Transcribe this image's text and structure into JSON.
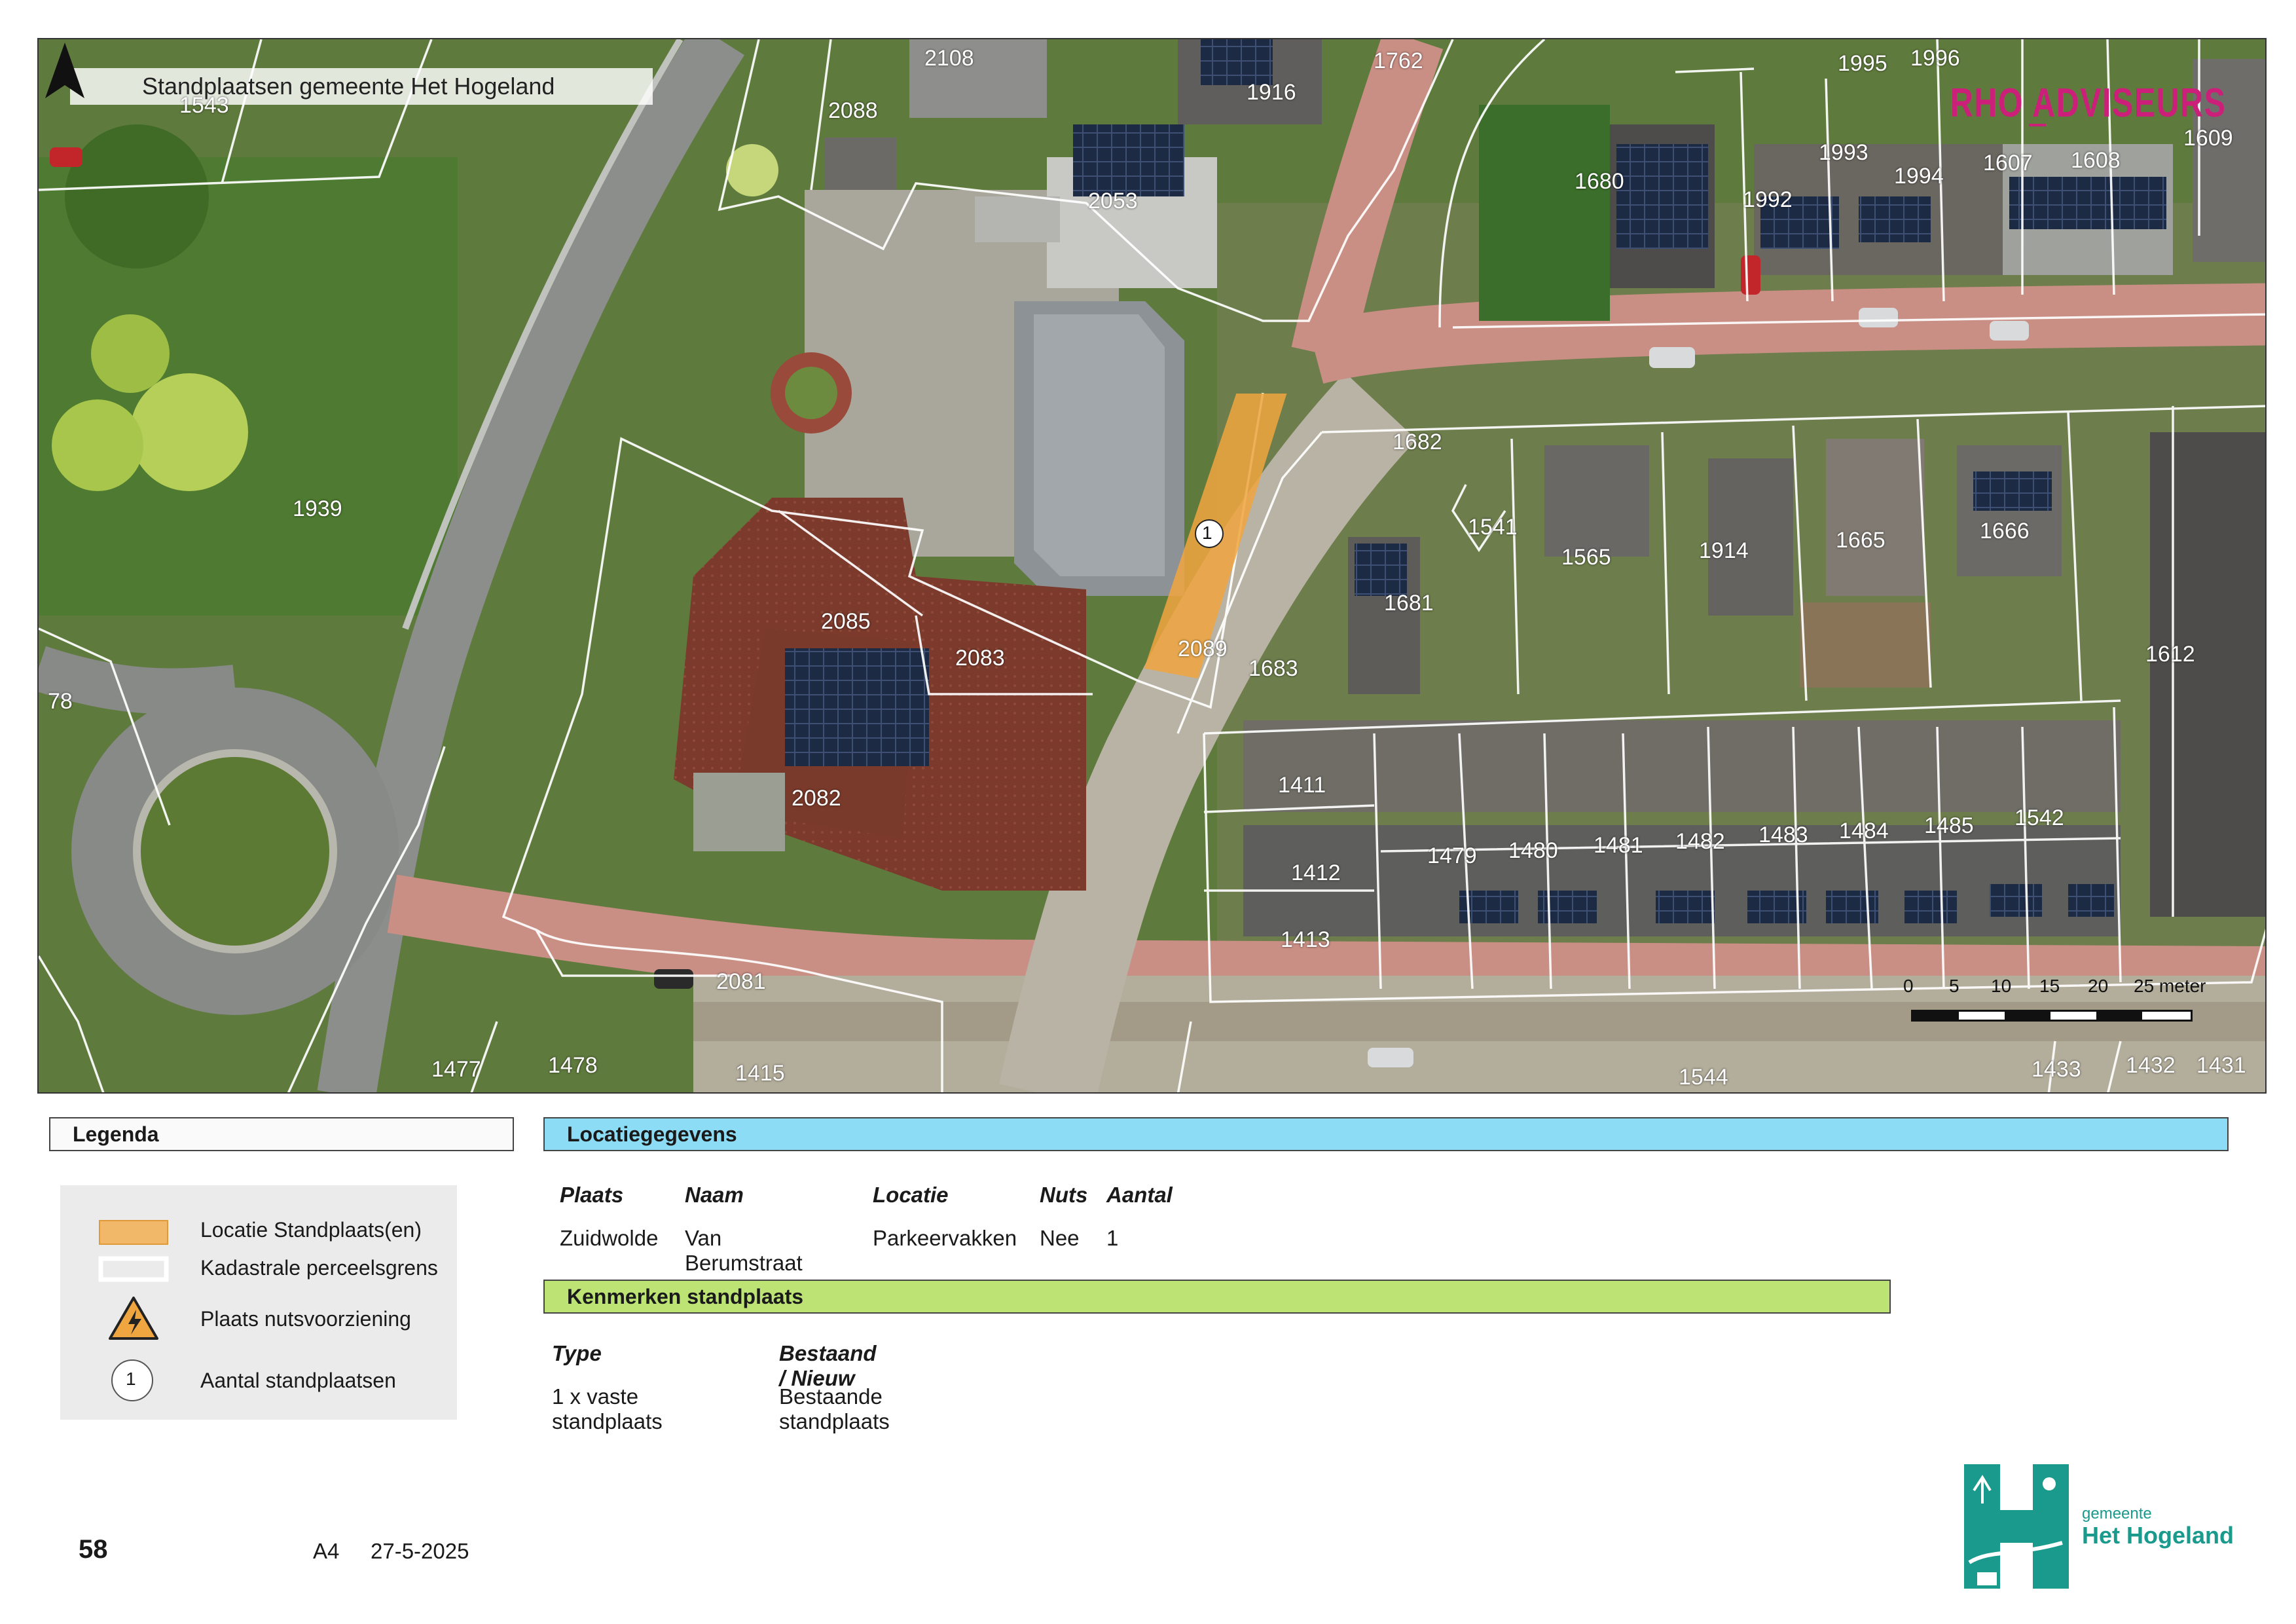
{
  "map": {
    "title": "Standplaatsen gemeente Het Hogeland",
    "brand": "RHO ADVISEURS",
    "brand_color": "#cc1f7a",
    "site_color": "#f0a640",
    "parcels": [
      "1543",
      "2108",
      "2088",
      "1916",
      "1762",
      "1995",
      "1996",
      "1680",
      "1993",
      "1992",
      "1994",
      "1607",
      "1608",
      "1609",
      "2053",
      "1939",
      "1682",
      "1541",
      "1565",
      "1914",
      "1665",
      "1666",
      "1681",
      "2085",
      "2083",
      "2089",
      "1683",
      "1612",
      "78",
      "1411",
      "1479",
      "1480",
      "1481",
      "1482",
      "1483",
      "1484",
      "1485",
      "1542",
      "1412",
      "2082",
      "1413",
      "2081",
      "1477",
      "1478",
      "1415",
      "1544",
      "1433",
      "1432",
      "1431"
    ],
    "site_marker": "1",
    "scale_ticks": [
      "0",
      "5",
      "10",
      "15",
      "20",
      "25 meter"
    ]
  },
  "legend": {
    "title": "Legenda",
    "items": [
      {
        "label": "Locatie Standplaats(en)",
        "icon": "orange-rect"
      },
      {
        "label": "Kadastrale perceelsgrens",
        "icon": "parcel-boundary"
      },
      {
        "label": "Plaats nutsvoorziening",
        "icon": "electricity-warning-icon"
      },
      {
        "label": "Aantal standplaatsen",
        "icon": "count-circle",
        "sample": "1"
      }
    ]
  },
  "location": {
    "title": "Locatiegegevens",
    "color": "#8ddcf5",
    "headers": [
      "Plaats",
      "Naam",
      "Locatie",
      "Nuts",
      "Aantal"
    ],
    "values": [
      "Zuidwolde",
      "Van Berumstraat",
      "Parkeervakken",
      "Nee",
      "1"
    ]
  },
  "features": {
    "title": "Kenmerken standplaats",
    "color": "#bde374",
    "headers": [
      "Type",
      "Bestaand / Nieuw"
    ],
    "values": [
      "1 x vaste standplaats",
      "Bestaande standplaats"
    ]
  },
  "footer": {
    "page_number": "58",
    "paper_size": "A4",
    "date": "27-5-2025",
    "municipality_line1": "gemeente",
    "municipality_line2": "Het Hogeland",
    "logo_color": "#1a9a8c"
  }
}
